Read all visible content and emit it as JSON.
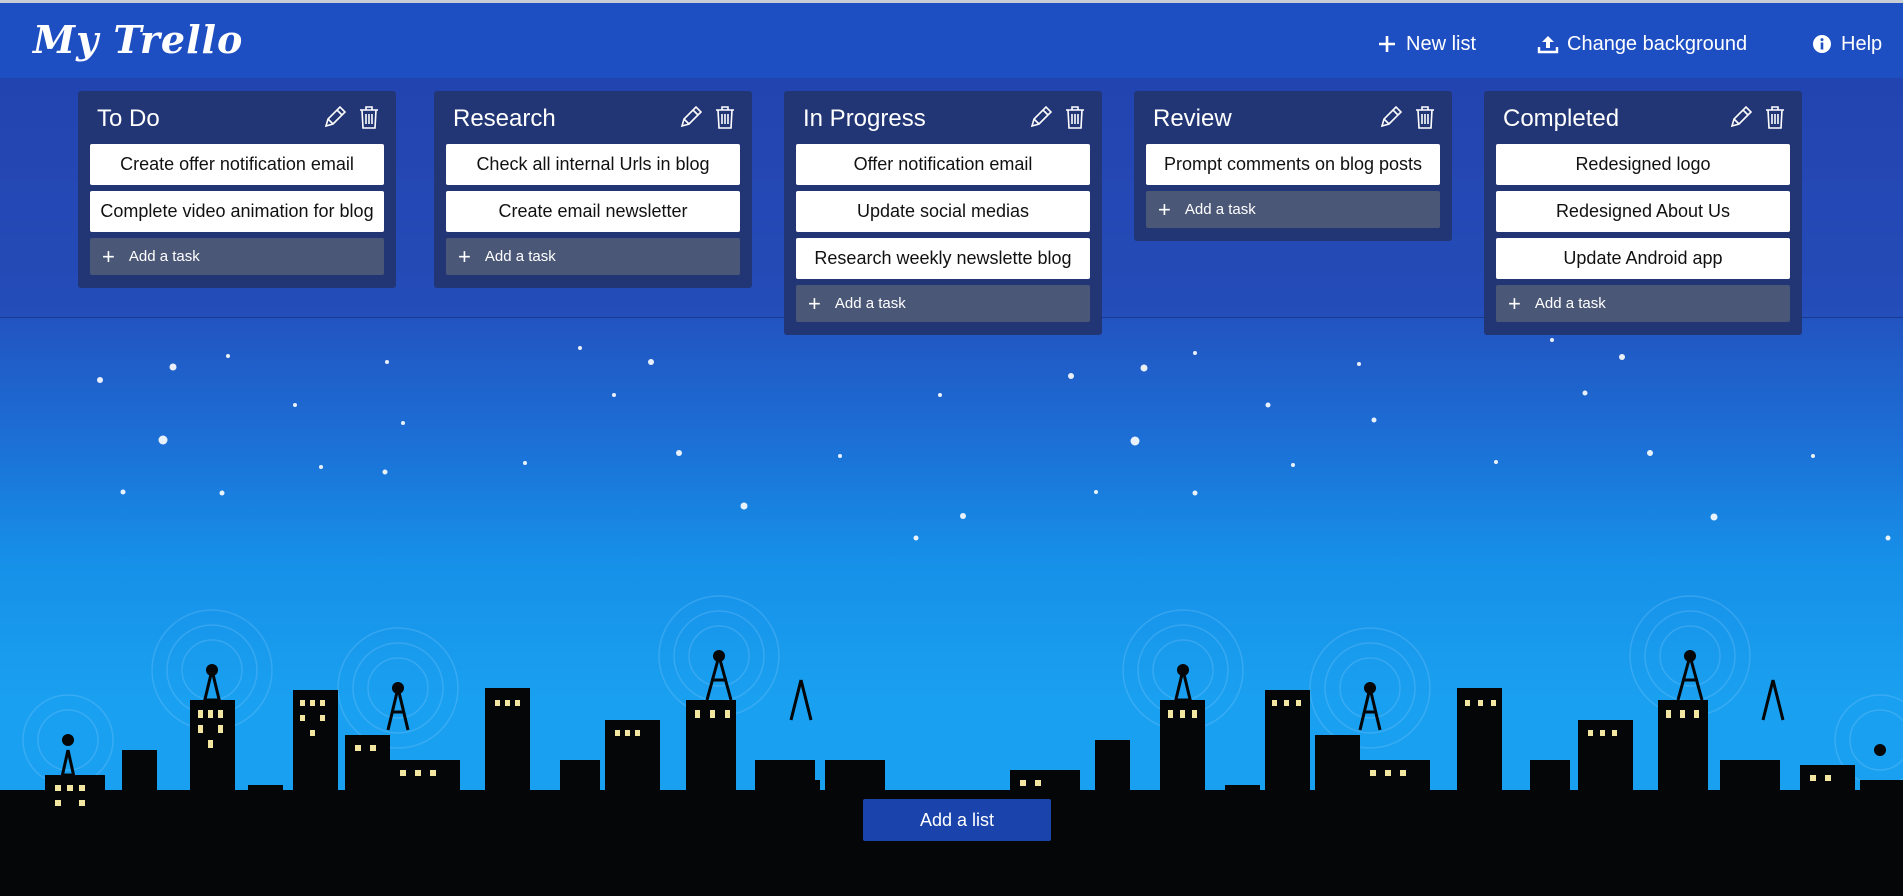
{
  "app": {
    "logo_text": "My Trello"
  },
  "navbar": {
    "new_list_label": "New list",
    "change_background_label": "Change background",
    "help_label": "Help"
  },
  "lists": [
    {
      "title": "To Do",
      "cards": [
        "Create offer notification email",
        "Complete video animation for blog"
      ],
      "add_task_label": "Add a task"
    },
    {
      "title": "Research",
      "cards": [
        "Check all internal Urls in blog",
        "Create email newsletter"
      ],
      "add_task_label": "Add a task"
    },
    {
      "title": "In Progress",
      "cards": [
        "Offer notification email",
        "Update social medias",
        "Research weekly newslette blog"
      ],
      "add_task_label": "Add a task"
    },
    {
      "title": "Review",
      "cards": [
        "Prompt comments on blog posts"
      ],
      "add_task_label": "Add a task"
    },
    {
      "title": "Completed",
      "cards": [
        "Redesigned logo",
        "Redesigned About Us",
        "Update Android app"
      ],
      "add_task_label": "Add a task"
    }
  ],
  "add_list_label": "Add a list",
  "colors": {
    "navbar": "#1e4fc2",
    "list_bg": "#223574",
    "add_task_bg": "#4a5777"
  }
}
